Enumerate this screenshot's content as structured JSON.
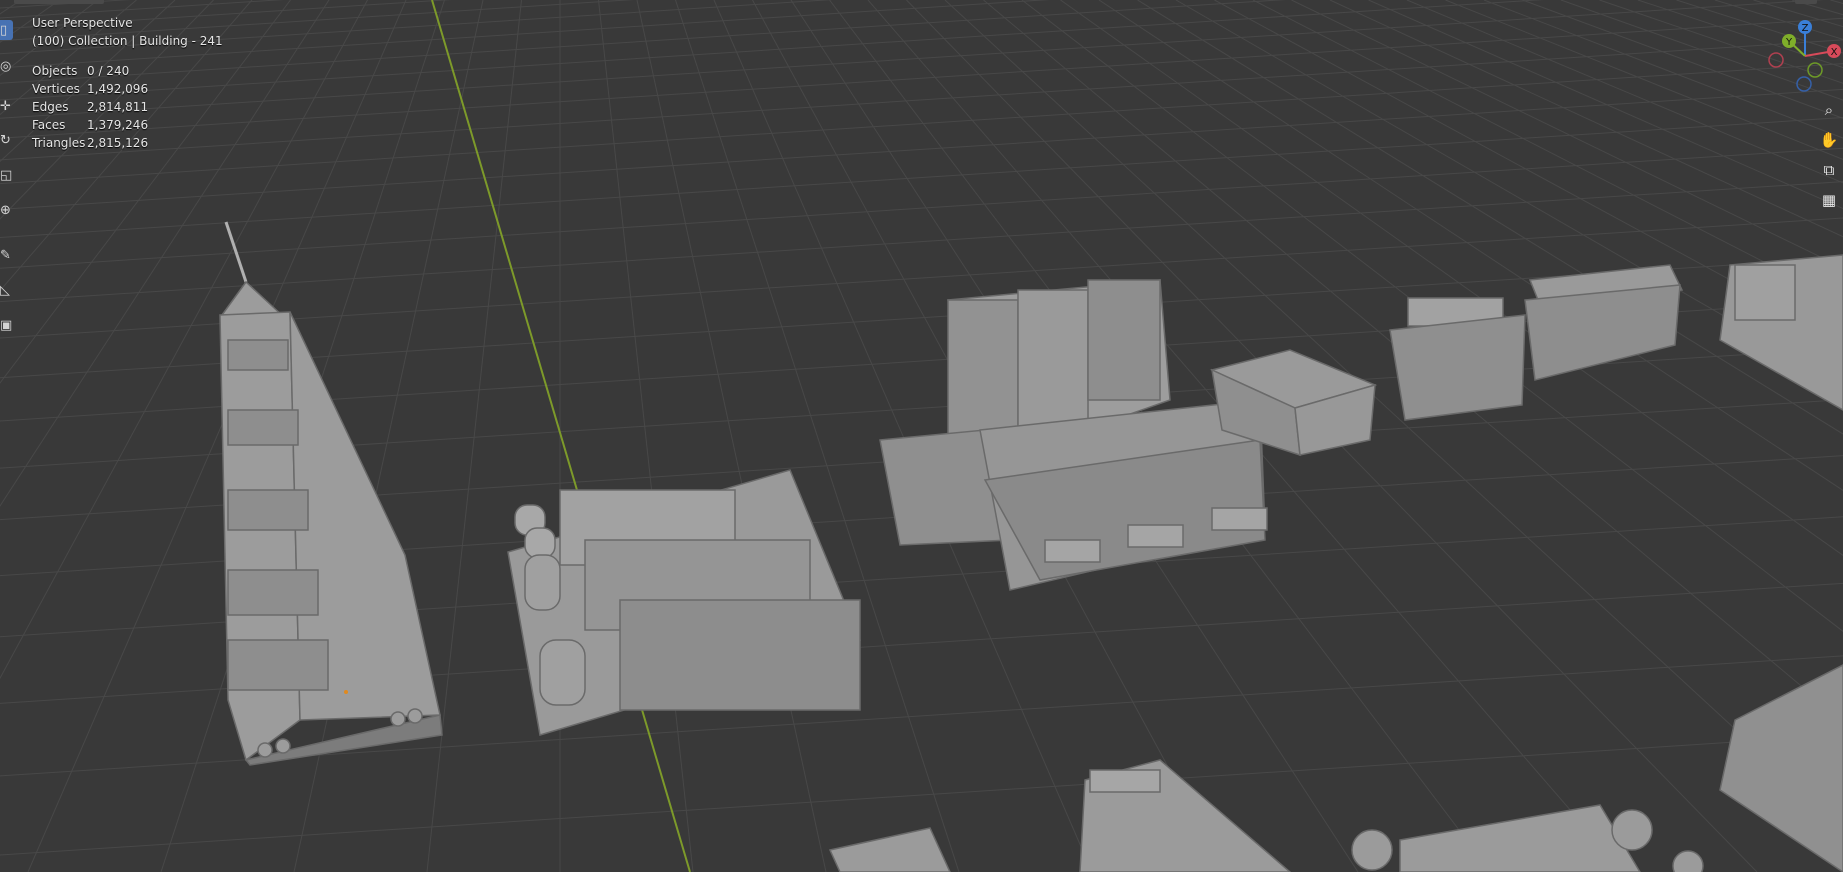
{
  "viewport": {
    "view_name": "User Perspective",
    "collection_info": "(100) Collection | Building - 241",
    "stats": [
      {
        "label": "Objects",
        "value": "0 / 240"
      },
      {
        "label": "Vertices",
        "value": "1,492,096"
      },
      {
        "label": "Edges",
        "value": "2,814,811"
      },
      {
        "label": "Faces",
        "value": "1,379,246"
      },
      {
        "label": "Triangles",
        "value": "2,815,126"
      }
    ]
  },
  "gizmo": {
    "z": "Z",
    "y": "Y",
    "x": "X"
  },
  "toolbar": {
    "tools": [
      "select-box",
      "cursor",
      "move",
      "rotate",
      "scale",
      "transform",
      "annotate",
      "measure",
      "add-cube"
    ]
  },
  "navigation": {
    "buttons": [
      "zoom",
      "pan",
      "camera",
      "grid"
    ]
  },
  "colors": {
    "background": "#393939",
    "grid": "#4a4a4a",
    "y_axis": "#8aaa2e",
    "active_tool": "#4772b3",
    "building": "#9a9a9a"
  }
}
